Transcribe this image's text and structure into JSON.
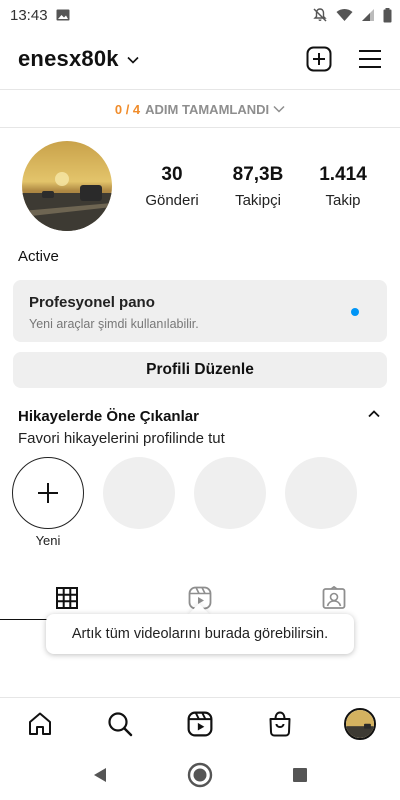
{
  "status_bar": {
    "time": "13:43",
    "icons": [
      "image-icon",
      "mute-bell-icon",
      "wifi-icon",
      "signal-icon",
      "battery-icon"
    ]
  },
  "header": {
    "username": "enesx80k",
    "icons": [
      "chevron-down-icon",
      "create-post-icon",
      "menu-icon"
    ]
  },
  "onboarding": {
    "progress": "0 / 4",
    "label": "ADIM TAMAMLANDI"
  },
  "profile": {
    "stats": [
      {
        "value": "30",
        "label": "Gönderi"
      },
      {
        "value": "87,3B",
        "label": "Takipçi"
      },
      {
        "value": "1.414",
        "label": "Takip"
      }
    ],
    "display_name": "Active"
  },
  "professional_dashboard": {
    "title": "Profesyonel pano",
    "subtitle": "Yeni araçlar şimdi kullanılabilir.",
    "accent_color": "#0095f6"
  },
  "edit_profile_label": "Profili Düzenle",
  "highlights": {
    "title": "Hikayelerde Öne Çıkanlar",
    "subtitle": "Favori hikayelerini profilinde tut",
    "new_label": "Yeni"
  },
  "tabs": [
    "grid-icon",
    "reels-icon",
    "tagged-icon"
  ],
  "tooltip": "Artık tüm videolarını burada görebilirsin.",
  "bottom_nav": [
    "home-icon",
    "search-icon",
    "reels-icon",
    "shop-icon",
    "profile-avatar"
  ],
  "system_nav": [
    "back-icon",
    "home-circle-icon",
    "recents-icon"
  ],
  "colors": {
    "progress_accent": "#f08c2b",
    "surface": "#efefef"
  }
}
